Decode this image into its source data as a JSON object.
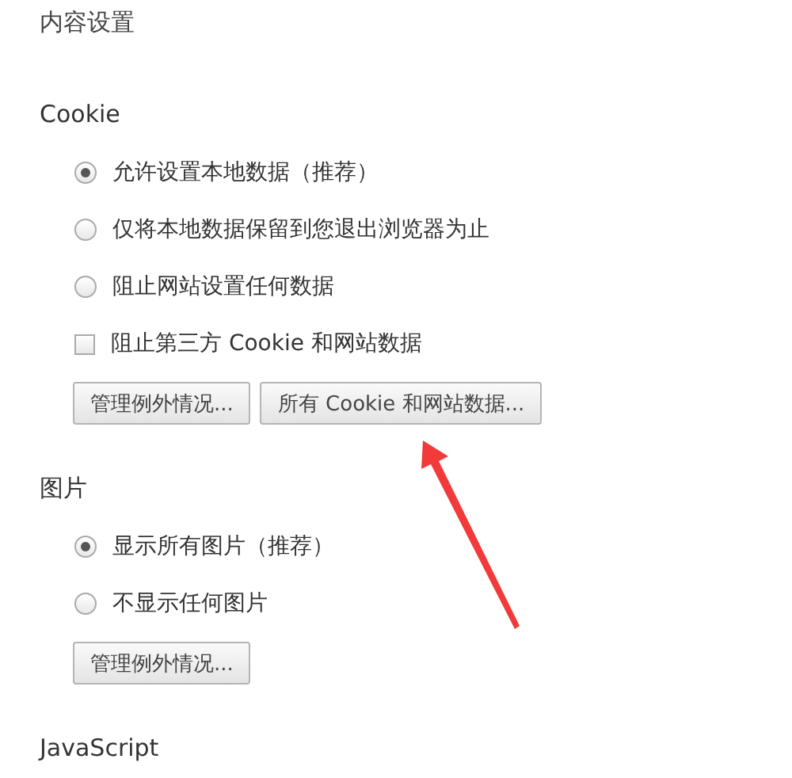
{
  "title": "内容设置",
  "sections": [
    {
      "heading": "Cookie",
      "options": [
        {
          "kind": "radio",
          "label": "允许设置本地数据（推荐）",
          "selected": true
        },
        {
          "kind": "radio",
          "label": "仅将本地数据保留到您退出浏览器为止",
          "selected": false
        },
        {
          "kind": "radio",
          "label": "阻止网站设置任何数据",
          "selected": false
        },
        {
          "kind": "checkbox",
          "label": "阻止第三方 Cookie 和网站数据",
          "checked": false
        }
      ],
      "buttons": [
        "管理例外情况...",
        "所有 Cookie 和网站数据..."
      ]
    },
    {
      "heading": "图片",
      "options": [
        {
          "kind": "radio",
          "label": "显示所有图片（推荐）",
          "selected": true
        },
        {
          "kind": "radio",
          "label": "不显示任何图片",
          "selected": false
        }
      ],
      "buttons": [
        "管理例外情况..."
      ]
    },
    {
      "heading": "JavaScript"
    }
  ]
}
